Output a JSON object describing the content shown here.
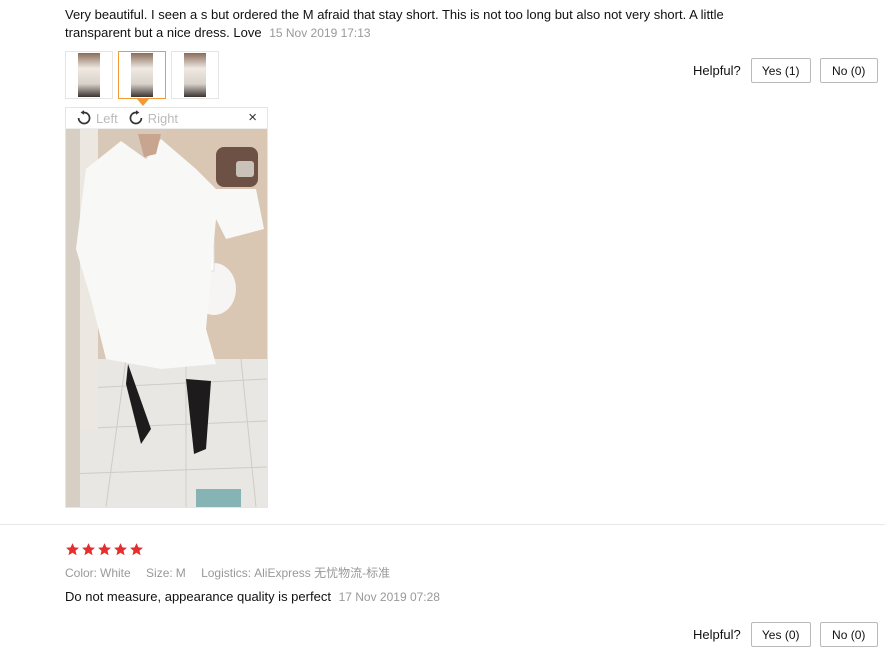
{
  "reviews": [
    {
      "text": "Very beautiful. I seen a s but ordered the M afraid that stay short. This is not too long but also not very short. A little transparent but a nice dress. Love",
      "date": "15 Nov 2019 17:13",
      "helpful": {
        "label": "Helpful?",
        "yes": "Yes (1)",
        "no": "No (0)"
      },
      "viewer": {
        "left_label": "Left",
        "right_label": "Right",
        "close": "×"
      }
    },
    {
      "stars": 5,
      "meta": {
        "color_key": "Color:",
        "color_val": "White",
        "size_key": "Size:",
        "size_val": "M",
        "logistics_key": "Logistics:",
        "logistics_val": "AliExpress 无忧物流-标准"
      },
      "text": "Do not measure, appearance quality is perfect",
      "date": "17 Nov 2019 07:28",
      "helpful": {
        "label": "Helpful?",
        "yes": "Yes (0)",
        "no": "No (0)"
      }
    }
  ],
  "colors": {
    "star": "#e62e2e",
    "accent": "#f29a38",
    "muted": "#999999"
  },
  "icons": [
    "rotate-left-icon",
    "rotate-right-icon",
    "close-icon",
    "star-icon"
  ]
}
